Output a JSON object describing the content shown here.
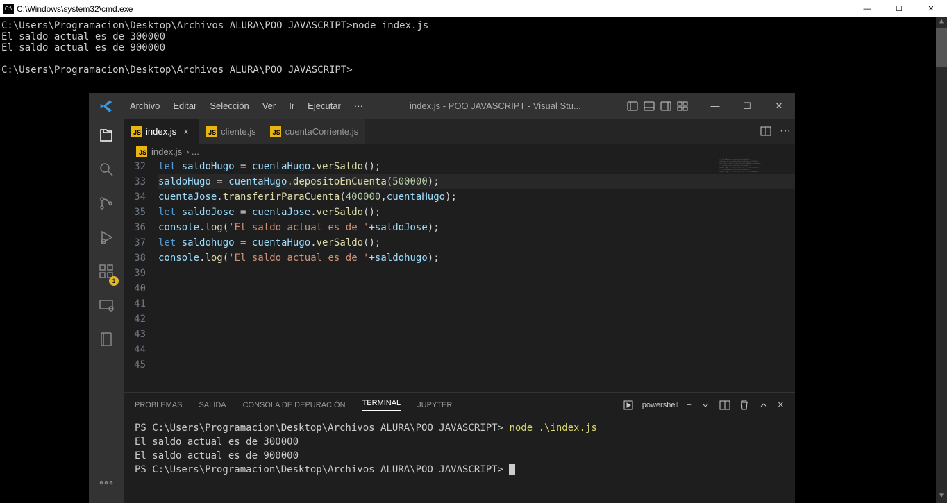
{
  "cmd": {
    "title": "C:\\Windows\\system32\\cmd.exe",
    "icon_label": "C:\\",
    "lines": [
      "C:\\Users\\Programacion\\Desktop\\Archivos ALURA\\POO JAVASCRIPT>node index.js",
      "El saldo actual es de 300000",
      "El saldo actual es de 900000",
      "",
      "C:\\Users\\Programacion\\Desktop\\Archivos ALURA\\POO JAVASCRIPT>"
    ]
  },
  "vsc": {
    "menu": [
      "Archivo",
      "Editar",
      "Selección",
      "Ver",
      "Ir",
      "Ejecutar",
      "···"
    ],
    "title": "index.js - POO JAVASCRIPT - Visual Stu...",
    "tabs": [
      {
        "file": "index.js",
        "active": true,
        "close": "×"
      },
      {
        "file": "cliente.js",
        "active": false
      },
      {
        "file": "cuentaCorriente.js",
        "active": false
      }
    ],
    "breadcrumb": {
      "file": "index.js",
      "sep": "› ..."
    },
    "activity_badge": "1",
    "lines": [
      {
        "n": 32,
        "tokens": []
      },
      {
        "n": 33,
        "tokens": [
          {
            "c": "k",
            "t": "let"
          },
          {
            "c": "p",
            "t": " "
          },
          {
            "c": "v",
            "t": "saldoHugo"
          },
          {
            "c": "p",
            "t": " = "
          },
          {
            "c": "v",
            "t": "cuentaHugo"
          },
          {
            "c": "p",
            "t": "."
          },
          {
            "c": "f",
            "t": "verSaldo"
          },
          {
            "c": "p",
            "t": "();"
          }
        ]
      },
      {
        "n": 34,
        "hl": true,
        "tokens": [
          {
            "c": "v",
            "t": "saldoHugo"
          },
          {
            "c": "p",
            "t": " = "
          },
          {
            "c": "v",
            "t": "cuentaHugo"
          },
          {
            "c": "p",
            "t": "."
          },
          {
            "c": "f",
            "t": "depositoEnCuenta"
          },
          {
            "c": "p",
            "t": "("
          },
          {
            "c": "n",
            "t": "500000"
          },
          {
            "c": "p",
            "t": ");"
          }
        ]
      },
      {
        "n": 35,
        "tokens": []
      },
      {
        "n": 36,
        "tokens": [
          {
            "c": "v",
            "t": "cuentaJose"
          },
          {
            "c": "p",
            "t": "."
          },
          {
            "c": "f",
            "t": "transferirParaCuenta"
          },
          {
            "c": "p",
            "t": "("
          },
          {
            "c": "n",
            "t": "400000"
          },
          {
            "c": "p",
            "t": ","
          },
          {
            "c": "v",
            "t": "cuentaHugo"
          },
          {
            "c": "p",
            "t": ");"
          }
        ]
      },
      {
        "n": 37,
        "tokens": []
      },
      {
        "n": 38,
        "tokens": [
          {
            "c": "k",
            "t": "let"
          },
          {
            "c": "p",
            "t": " "
          },
          {
            "c": "v",
            "t": "saldoJose"
          },
          {
            "c": "p",
            "t": " = "
          },
          {
            "c": "v",
            "t": "cuentaJose"
          },
          {
            "c": "p",
            "t": "."
          },
          {
            "c": "f",
            "t": "verSaldo"
          },
          {
            "c": "p",
            "t": "();"
          }
        ]
      },
      {
        "n": 39,
        "tokens": [
          {
            "c": "v",
            "t": "console"
          },
          {
            "c": "p",
            "t": "."
          },
          {
            "c": "f",
            "t": "log"
          },
          {
            "c": "p",
            "t": "("
          },
          {
            "c": "s",
            "t": "'El saldo actual es de '"
          },
          {
            "c": "p",
            "t": "+"
          },
          {
            "c": "v",
            "t": "saldoJose"
          },
          {
            "c": "p",
            "t": ");"
          }
        ]
      },
      {
        "n": 40,
        "tokens": []
      },
      {
        "n": 41,
        "tokens": [
          {
            "c": "k",
            "t": "let"
          },
          {
            "c": "p",
            "t": " "
          },
          {
            "c": "v",
            "t": "saldohugo"
          },
          {
            "c": "p",
            "t": " = "
          },
          {
            "c": "v",
            "t": "cuentaHugo"
          },
          {
            "c": "p",
            "t": "."
          },
          {
            "c": "f",
            "t": "verSaldo"
          },
          {
            "c": "p",
            "t": "();"
          }
        ]
      },
      {
        "n": 42,
        "tokens": [
          {
            "c": "v",
            "t": "console"
          },
          {
            "c": "p",
            "t": "."
          },
          {
            "c": "f",
            "t": "log"
          },
          {
            "c": "p",
            "t": "("
          },
          {
            "c": "s",
            "t": "'El saldo actual es de '"
          },
          {
            "c": "p",
            "t": "+"
          },
          {
            "c": "v",
            "t": "saldohugo"
          },
          {
            "c": "p",
            "t": ");"
          }
        ]
      },
      {
        "n": 43,
        "tokens": []
      },
      {
        "n": 44,
        "tokens": []
      },
      {
        "n": 45,
        "tokens": []
      }
    ],
    "panel": {
      "tabs": [
        "PROBLEMAS",
        "SALIDA",
        "CONSOLA DE DEPURACIÓN",
        "TERMINAL",
        "JUPYTER"
      ],
      "active": "TERMINAL",
      "shell": "powershell",
      "plus": "+",
      "lines": [
        {
          "pre": "PS C:\\Users\\Programacion\\Desktop\\Archivos ALURA\\POO JAVASCRIPT> ",
          "cmd": "node .\\index.js"
        },
        {
          "pre": "El saldo actual es de 300000"
        },
        {
          "pre": "El saldo actual es de 900000"
        },
        {
          "pre": "PS C:\\Users\\Programacion\\Desktop\\Archivos ALURA\\POO JAVASCRIPT> ",
          "cursor": true
        }
      ]
    }
  },
  "win_controls": {
    "min": "—",
    "max": "☐",
    "close": "✕"
  }
}
